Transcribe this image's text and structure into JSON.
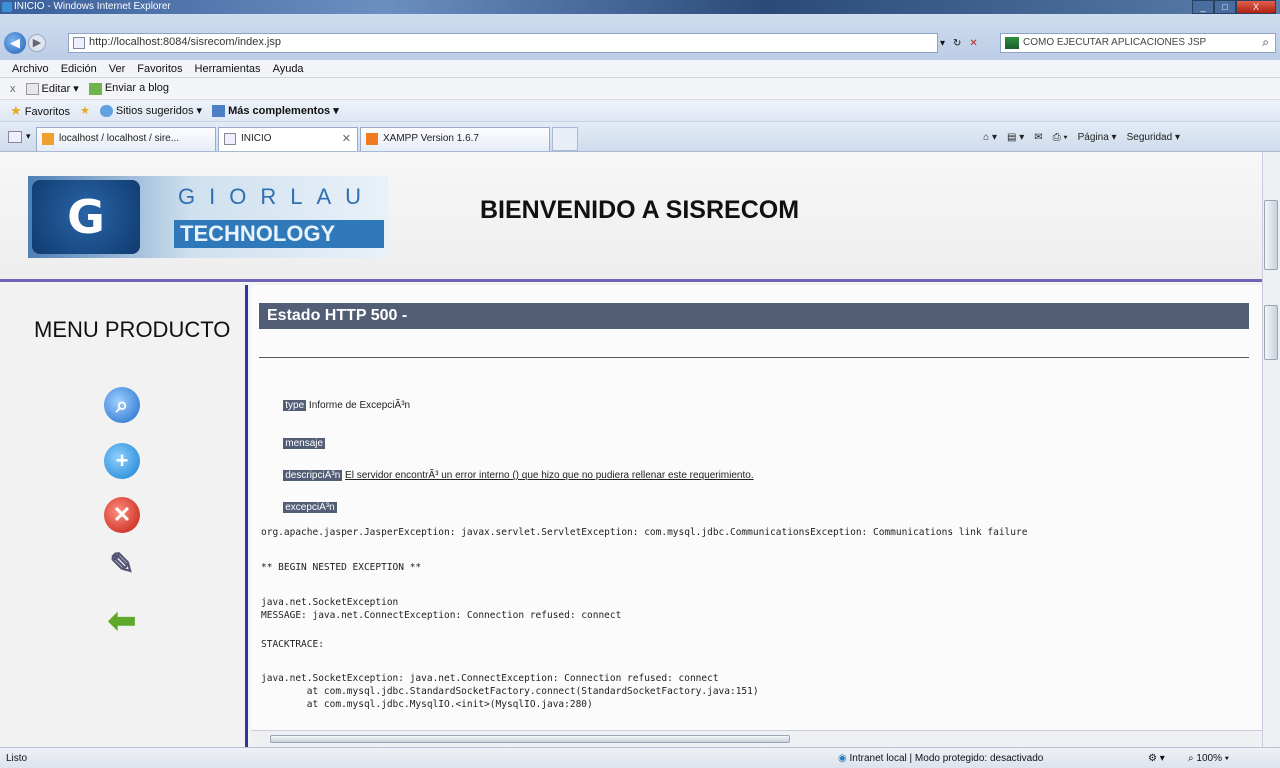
{
  "window": {
    "title": "INICIO - Windows Internet Explorer",
    "colors": {
      "accent": "#525d76",
      "divider": "#2b39a8"
    }
  },
  "address": {
    "url": "http://localhost:8084/sisrecom/index.jsp",
    "search_text": "COMO EJECUTAR APLICACIONES JSP"
  },
  "menu": [
    "Archivo",
    "Edición",
    "Ver",
    "Favoritos",
    "Herramientas",
    "Ayuda"
  ],
  "toolbar": {
    "close_label": "x",
    "edit_label": "Editar",
    "blog_label": "Enviar a blog"
  },
  "favorites": {
    "favorites_label": "Favoritos",
    "suggested_label": "Sitios sugeridos",
    "more_label": "Más complementos"
  },
  "tabs": [
    {
      "label": "localhost / localhost / sire...",
      "icon": "phpmyadmin-icon"
    },
    {
      "label": "INICIO",
      "icon": "page-icon",
      "active": true
    },
    {
      "label": "XAMPP Version 1.6.7",
      "icon": "xampp-icon"
    }
  ],
  "commands": {
    "page_label": "Página",
    "security_label": "Seguridad"
  },
  "banner": {
    "logo_word": "GIORLAU",
    "logo_sub": "TECHNOLOGY",
    "title": "BIENVENIDO A SISRECOM"
  },
  "sidebar": {
    "title": "MENU PRODUCTO",
    "icons": [
      "search-icon",
      "add-icon",
      "delete-icon",
      "edit-icon",
      "back-arrow-icon"
    ]
  },
  "error": {
    "heading": "Estado HTTP 500 -",
    "type_label": "type",
    "type_value": "Informe de ExcepciÃ³n",
    "message_label": "mensaje",
    "description_label": "descripciÃ³n",
    "description_value": "El servidor encontrÃ³ un error interno () que hizo que no pudiera rellenar este requerimiento.",
    "exception_label": "excepciÃ³n",
    "exception_line": "org.apache.jasper.JasperException: javax.servlet.ServletException: com.mysql.jdbc.CommunicationsException: Communications link failure",
    "nested_begin": "** BEGIN NESTED EXCEPTION **",
    "socket_exception": "java.net.SocketException",
    "message_line": "MESSAGE: java.net.ConnectException: Connection refused: connect",
    "stacktrace_label": "STACKTRACE:",
    "trace1": "java.net.SocketException: java.net.ConnectException: Connection refused: connect",
    "trace2": "        at com.mysql.jdbc.StandardSocketFactory.connect(StandardSocketFactory.java:151)",
    "trace3": "        at com.mysql.jdbc.MysqlIO.<init>(MysqlIO.java:280)"
  },
  "status": {
    "left": "Listo",
    "zone": "Intranet local | Modo protegido: desactivado",
    "zoom": "100%"
  }
}
